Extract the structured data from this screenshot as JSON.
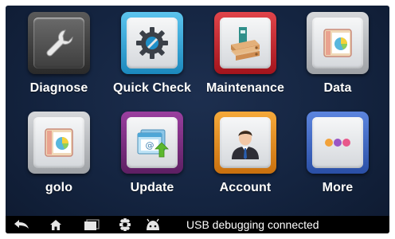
{
  "apps": [
    {
      "label": "Diagnose",
      "icon": "wrench-icon",
      "frame_color": "#3a3a3a"
    },
    {
      "label": "Quick Check",
      "icon": "gear-icon",
      "frame_color": "#29a3d6"
    },
    {
      "label": "Maintenance",
      "icon": "binders-icon",
      "frame_color": "#c8242c"
    },
    {
      "label": "Data",
      "icon": "chart-folder-icon",
      "frame_color": "#b9bcc0"
    },
    {
      "label": "golo",
      "icon": "golo-folder-icon",
      "frame_color": "#b9bcc0"
    },
    {
      "label": "Update",
      "icon": "update-window-icon",
      "frame_color": "#7a2c7e"
    },
    {
      "label": "Account",
      "icon": "user-icon",
      "frame_color": "#e8901a"
    },
    {
      "label": "More",
      "icon": "dots-icon",
      "frame_color": "#3b67c8"
    }
  ],
  "statusbar": {
    "text": "USB debugging connected",
    "icons": [
      "back-icon",
      "home-icon",
      "recent-apps-icon",
      "usb-debug-icon",
      "android-icon"
    ]
  }
}
